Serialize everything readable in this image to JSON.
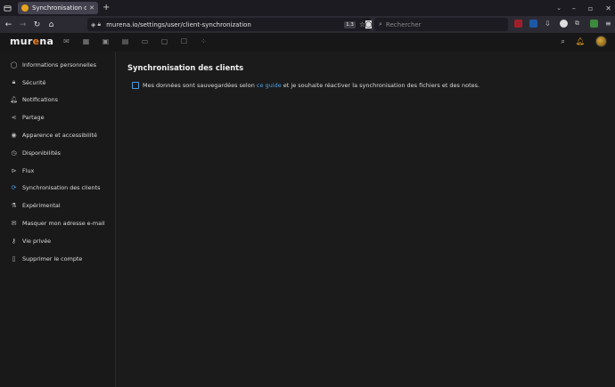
{
  "browser": {
    "tab_title": "Synchronisation des clien",
    "tab_close": "✕",
    "new_tab": "+",
    "url": "murena.io/settings/user/client-synchronization",
    "zoom": "1.3",
    "search_placeholder": "Rechercher",
    "window_controls": [
      "–",
      "▫",
      "✕"
    ]
  },
  "app": {
    "logo_pre": "mur",
    "logo_accent": "e",
    "logo_post": "na",
    "header_icons": [
      "mail-icon",
      "calendar-icon",
      "contacts-icon",
      "files-icon",
      "folder-icon",
      "notes-icon",
      "tasks-icon",
      "more-icon"
    ]
  },
  "sidebar": {
    "items": [
      {
        "label": "Informations personnelles",
        "icon": "user-icon"
      },
      {
        "label": "Sécurité",
        "icon": "lock-icon"
      },
      {
        "label": "Notifications",
        "icon": "bell-icon"
      },
      {
        "label": "Partage",
        "icon": "share-icon"
      },
      {
        "label": "Apparence et accessibilité",
        "icon": "eye-icon"
      },
      {
        "label": "Disponibilités",
        "icon": "clock-icon"
      },
      {
        "label": "Flux",
        "icon": "flash-icon"
      },
      {
        "label": "Synchronisation des clients",
        "icon": "sync-icon"
      },
      {
        "label": "Expérimental",
        "icon": "flask-icon"
      },
      {
        "label": "Masquer mon adresse e-mail",
        "icon": "email-icon"
      },
      {
        "label": "Vie privée",
        "icon": "key-icon"
      },
      {
        "label": "Supprimer le compte",
        "icon": "trash-icon"
      }
    ],
    "active_index": 7
  },
  "main": {
    "title": "Synchronisation des clients",
    "checkbox_text_before": "Mes données sont sauvegardées selon ",
    "checkbox_link": "ce guide",
    "checkbox_text_after": " et je souhaite réactiver la synchronisation des fichiers et des notes."
  },
  "colors": {
    "accent": "#4aa0e6",
    "logo_accent": "#e87d1e",
    "background": "#1b1b1b"
  }
}
